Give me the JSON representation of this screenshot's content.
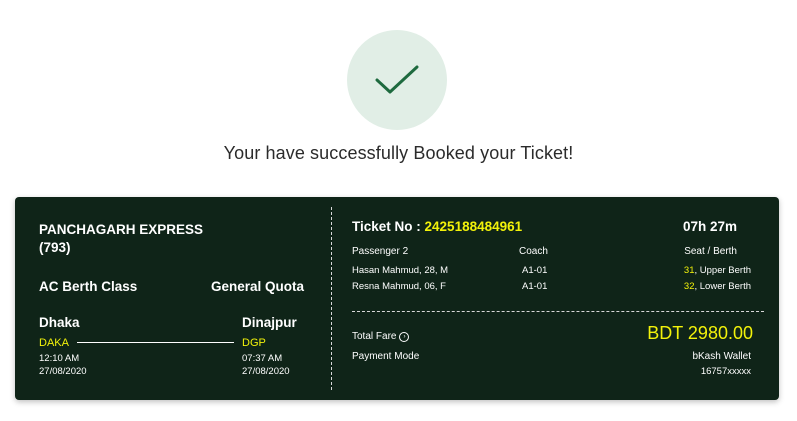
{
  "success": {
    "message": "Your have successfully Booked your Ticket!",
    "check_color": "#1e6a3f",
    "circle_color": "#e1eee6"
  },
  "ticket": {
    "train_name": "PANCHAGARH EXPRESS",
    "train_number": "(793)",
    "class": "AC Berth Class",
    "quota": "General Quota",
    "from": {
      "city": "Dhaka",
      "code": "DAKA",
      "time": "12:10 AM",
      "date": "27/08/2020"
    },
    "to": {
      "city": "Dinajpur",
      "code": "DGP",
      "time": "07:37 AM",
      "date": "27/08/2020"
    },
    "ticket_no_label": "Ticket No :",
    "ticket_no": "2425188484961",
    "duration": "07h 27m",
    "headers": {
      "passenger": "Passenger 2",
      "coach": "Coach",
      "seat": "Seat / Berth"
    },
    "passengers": [
      {
        "name": "Hasan Mahmud, 28, M",
        "coach": "A1-01",
        "seat_no": "31",
        "berth": ", Upper Berth"
      },
      {
        "name": "Resna Mahmud, 06, F",
        "coach": "A1-01",
        "seat_no": "32",
        "berth": ", Lower Berth"
      }
    ],
    "total_fare_label": "Total Fare",
    "total_fare": "BDT 2980.00",
    "payment_mode_label": "Payment Mode",
    "payment_method": "bKash Wallet",
    "payment_account": "16757xxxxx",
    "background_color": "#0f2418",
    "accent_color": "#f2f20a"
  }
}
